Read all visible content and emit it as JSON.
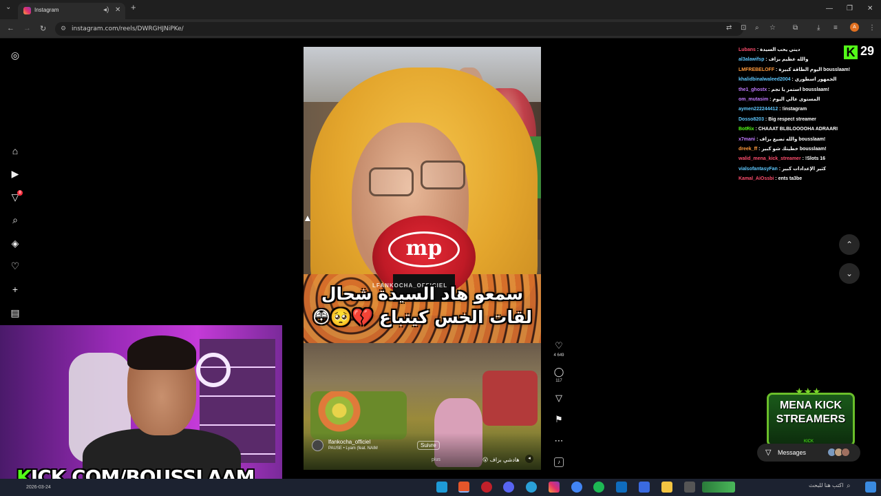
{
  "browser": {
    "tab_title": "Instagram",
    "url": "instagram.com/reels/DWRGHJNiPKe/",
    "profile_initial": "A"
  },
  "sidebar": {
    "icons": [
      "instagram-icon",
      "home-icon",
      "reels-icon",
      "direct-icon",
      "search-icon",
      "explore-icon",
      "notifications-icon",
      "create-icon",
      "dashboard-icon"
    ],
    "notification_badge": "8"
  },
  "reel": {
    "caption": "سمعو هاد السيدة شحال لقات الخس كيتباع 💔🥺😳",
    "watermark": "LFANKOCHA_OFFICIEL",
    "mic_logo": "mp",
    "author": "lfankocha_officiel",
    "follow": "Suivre",
    "audio": "PAUSE • Lyam (feat. NAIM",
    "description": "هادشي بزاف 😮",
    "more": "plus",
    "likes": "4 649",
    "comments": "117"
  },
  "chat": [
    {
      "user": "Lubans",
      "msg": ": ديني يحب السيدة",
      "color": "#ff4d6d"
    },
    {
      "user": "al3alawifsp",
      "msg": ": والله عظيم بزاف",
      "color": "#5ec8ff"
    },
    {
      "user": "LMFREBELOFF",
      "msg": ": اليوم الطاقة كبيرة bousslaam!",
      "color": "#ff9a3c"
    },
    {
      "user": "khalidbinalwaleed2004",
      "msg": ": الجمهور اسطوري",
      "color": "#5ec8ff"
    },
    {
      "user": "the1_ghostx",
      "msg": ": استمر يا نجم bousslaam!",
      "color": "#c07aff"
    },
    {
      "user": "om_mutasim",
      "msg": ": المستوى عالي اليوم",
      "color": "#c07aff"
    },
    {
      "user": "aymen222244412",
      "msg": ": !instagram",
      "color": "#5ec8ff"
    },
    {
      "user": "Dosso8203",
      "msg": ": Big respect streamer",
      "color": "#5ec8ff"
    },
    {
      "user": "BotRix",
      "msg": ": CHAAAT BLBLOOOOHA ADRAARI",
      "color": "#53fc18"
    },
    {
      "user": "x7mani",
      "msg": ": والله تضيع بزاف bousslaam!",
      "color": "#c07aff"
    },
    {
      "user": "dreek_ff",
      "msg": ": خطيتك شو كبير bousslaam!",
      "color": "#ff9a3c"
    },
    {
      "user": "walid_mena_kick_streamer",
      "msg": ": !Slots 16",
      "color": "#ff4d6d"
    },
    {
      "user": "vialsofantasyFan",
      "msg": ": كثير الإعدادات كبير",
      "color": "#5ec8ff"
    },
    {
      "user": "Kamal_AiOssbi",
      "msg": ": ents ta3be",
      "color": "#ff4d6d"
    }
  ],
  "viewers": "29",
  "webcam_text_k": "K",
  "webcam_text": "ICK.COM/BOUSSLAAM",
  "mena_badge": {
    "line1": "MENA KICK",
    "line2": "STREAMERS",
    "tag": "KICK"
  },
  "messages_label": "Messages",
  "taskbar": {
    "date": "2026-03-24",
    "search": "اكتب هنا للبحث"
  },
  "colors": {
    "kick_green": "#53fc18",
    "mic_red": "#c01a26",
    "scarf_yellow": "#e3a52c"
  }
}
